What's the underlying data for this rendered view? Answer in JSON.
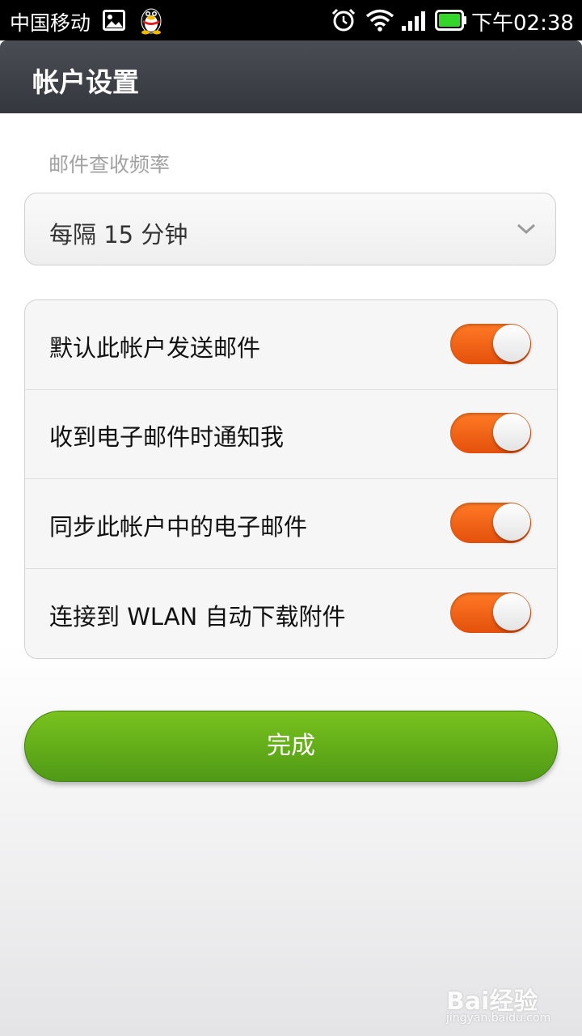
{
  "status_bar": {
    "carrier": "中国移动",
    "time": "下午02:38",
    "icons": [
      "image-icon",
      "qq-penguin-icon",
      "alarm-icon",
      "wifi-icon",
      "signal-icon",
      "battery-icon"
    ]
  },
  "header": {
    "title": "帐户设置"
  },
  "check_frequency": {
    "label": "邮件查收频率",
    "selected": "每隔 15 分钟"
  },
  "settings": [
    {
      "label": "默认此帐户发送邮件",
      "enabled": true
    },
    {
      "label": "收到电子邮件时通知我",
      "enabled": true
    },
    {
      "label": "同步此帐户中的电子邮件",
      "enabled": true
    },
    {
      "label": "连接到 WLAN 自动下载附件",
      "enabled": true
    }
  ],
  "done_button": {
    "label": "完成"
  },
  "watermark": {
    "logo": "Bai经验",
    "url": "jingyan.baidu.com"
  },
  "colors": {
    "toggle_on": "#f0651a",
    "button_green": "#64ae1a",
    "title_bar": "#3d4046"
  }
}
